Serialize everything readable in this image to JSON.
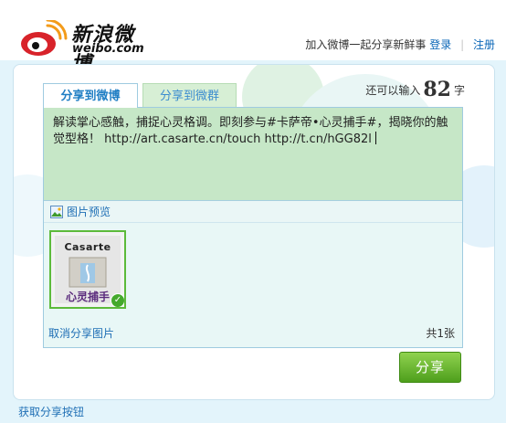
{
  "header": {
    "logo_cn": "新浪微博",
    "logo_en": "weibo.com",
    "tagline": "加入微博一起分享新鲜事",
    "login_label": "登录",
    "separator": "|",
    "register_label": "注册"
  },
  "tabs": [
    {
      "label": "分享到微博",
      "active": true
    },
    {
      "label": "分享到微群",
      "active": false
    }
  ],
  "counter": {
    "prefix": "还可以输入",
    "remaining": "82",
    "suffix": "字"
  },
  "compose": {
    "text": "解读掌心感触，捕捉心灵格调。即刻参与#卡萨帝•心灵捕手#，揭晓你的触觉型格！  http://art.casarte.cn/touch http://t.cn/hGG82l"
  },
  "preview": {
    "label": "图片预览",
    "thumb_brand": "Casarte",
    "thumb_slogan": "心灵捕手",
    "cancel_label": "取消分享图片",
    "count_text": "共1张"
  },
  "share_button_label": "分享",
  "footer_link": "获取分享按钮",
  "colors": {
    "accent_blue": "#1f6fb5",
    "compose_green": "#c6e7c7",
    "share_green": "#5aaa22",
    "page_bg": "#e3f4fb"
  }
}
